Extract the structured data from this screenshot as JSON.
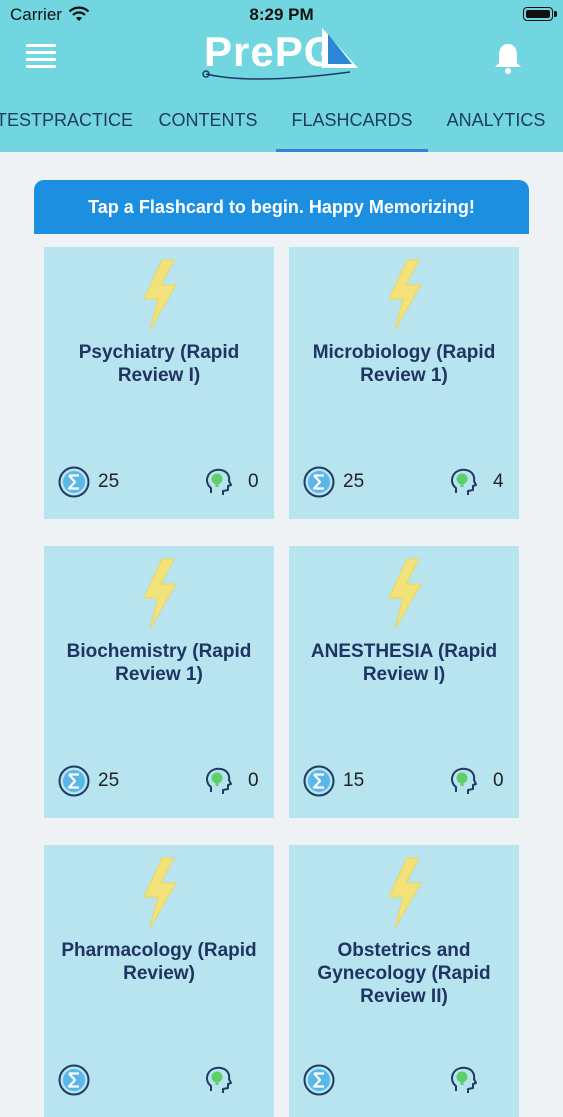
{
  "status_bar": {
    "carrier": "Carrier",
    "time": "8:29 PM"
  },
  "header": {
    "logo_text": "PrePG"
  },
  "tabs": [
    {
      "label": "TESTPRACTICE",
      "active": false
    },
    {
      "label": "CONTENTS",
      "active": false
    },
    {
      "label": "FLASHCARDS",
      "active": true
    },
    {
      "label": "ANALYTICS",
      "active": false
    }
  ],
  "banner": {
    "text": "Tap a Flashcard to begin. Happy Memorizing!"
  },
  "cards": [
    {
      "title": "Psychiatry (Rapid Review I)",
      "total": "25",
      "learned": "0"
    },
    {
      "title": "Microbiology (Rapid Review 1)",
      "total": "25",
      "learned": "4"
    },
    {
      "title": "Biochemistry (Rapid Review 1)",
      "total": "25",
      "learned": "0"
    },
    {
      "title": "ANESTHESIA (Rapid Review I)",
      "total": "15",
      "learned": "0"
    },
    {
      "title": "Pharmacology (Rapid Review)",
      "total": "",
      "learned": ""
    },
    {
      "title": "Obstetrics and Gynecology (Rapid Review II)",
      "total": "",
      "learned": ""
    }
  ],
  "colors": {
    "header": "#72d6e1",
    "banner": "#1d8fe0",
    "card": "#b7e4ee",
    "bolt": "#f3e27a",
    "title": "#1f3463"
  },
  "icons": {
    "menu": "hamburger-icon",
    "notifications": "bell-icon",
    "card": "lightning-bolt-icon",
    "total": "sigma-icon",
    "learned": "brain-head-icon"
  }
}
